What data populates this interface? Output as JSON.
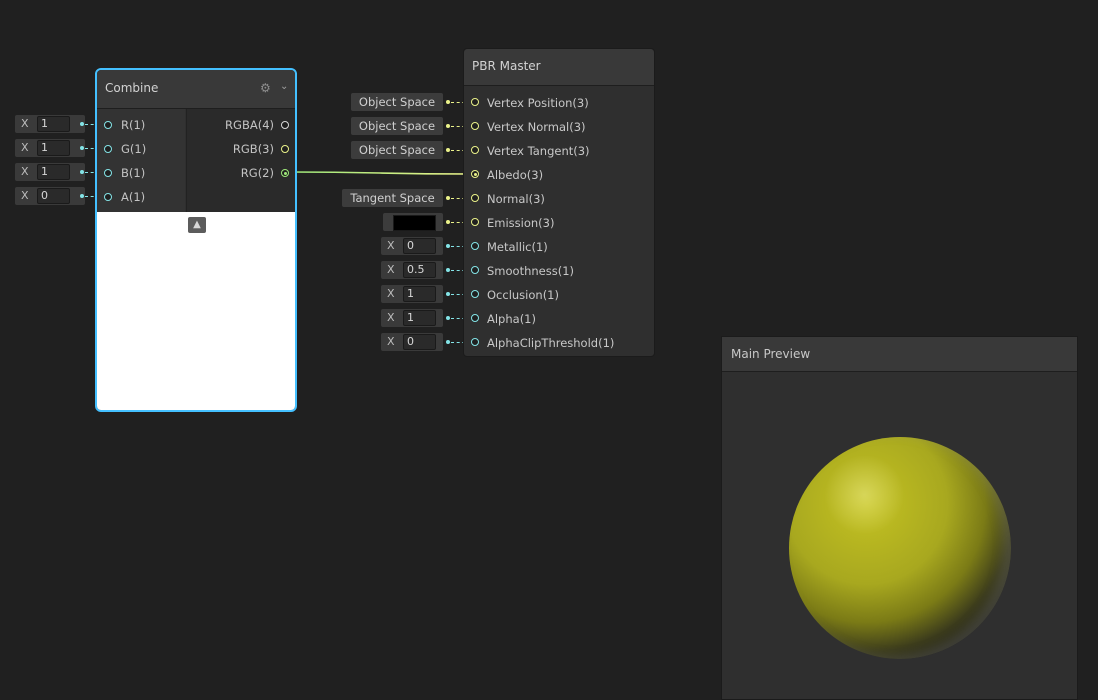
{
  "combine": {
    "title": "Combine",
    "inputs": [
      {
        "label": "R(1)",
        "axis": "X",
        "value": "1"
      },
      {
        "label": "G(1)",
        "axis": "X",
        "value": "1"
      },
      {
        "label": "B(1)",
        "axis": "X",
        "value": "1"
      },
      {
        "label": "A(1)",
        "axis": "X",
        "value": "0"
      }
    ],
    "outputs": [
      {
        "label": "RGBA(4)"
      },
      {
        "label": "RGB(3)"
      },
      {
        "label": "RG(2)"
      }
    ],
    "preview_color": "#ffffff"
  },
  "pbr_master": {
    "title": "PBR Master",
    "ports": [
      {
        "label": "Vertex Position(3)",
        "control": "Object Space"
      },
      {
        "label": "Vertex Normal(3)",
        "control": "Object Space"
      },
      {
        "label": "Vertex Tangent(3)",
        "control": "Object Space"
      },
      {
        "label": "Albedo(3)",
        "control": ""
      },
      {
        "label": "Normal(3)",
        "control": "Tangent Space"
      },
      {
        "label": "Emission(3)",
        "control": "#000000"
      },
      {
        "label": "Metallic(1)",
        "axis": "X",
        "value": "0"
      },
      {
        "label": "Smoothness(1)",
        "axis": "X",
        "value": "0.5"
      },
      {
        "label": "Occlusion(1)",
        "axis": "X",
        "value": "1"
      },
      {
        "label": "Alpha(1)",
        "axis": "X",
        "value": "1"
      },
      {
        "label": "AlphaClipThreshold(1)",
        "axis": "X",
        "value": "0"
      }
    ]
  },
  "main_preview": {
    "title": "Main Preview",
    "sphere_color": "#c4c222"
  },
  "colors": {
    "background": "#202020",
    "node": "#2f2f2f",
    "selection": "#44c0ff",
    "port_vector1": "#84e4e7",
    "port_vector3": "#eaf28a",
    "port_vector2": "#9ee87a"
  }
}
